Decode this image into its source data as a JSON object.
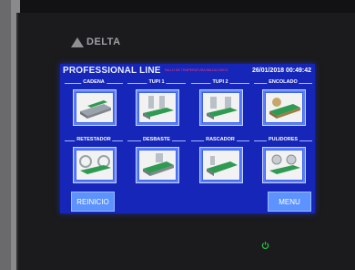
{
  "brand": {
    "logo_text": "DELTA"
  },
  "header": {
    "title": "PROFESSIONAL LINE",
    "warning": "FALLO DE TEMPERATURA BALDA   DISCO",
    "datetime": "26/01/2018 00:49:42"
  },
  "tiles": [
    {
      "label": "CADENA",
      "icon": "conveyor-chain-icon"
    },
    {
      "label": "TUPI 1",
      "icon": "spindle-1-icon"
    },
    {
      "label": "TUPI 2",
      "icon": "spindle-2-icon"
    },
    {
      "label": "ENCOLADO",
      "icon": "gluing-icon"
    },
    {
      "label": "RETESTADOR",
      "icon": "end-trimmer-icon"
    },
    {
      "label": "DESBASTE",
      "icon": "roughing-icon"
    },
    {
      "label": "RASCADOR",
      "icon": "scraper-icon"
    },
    {
      "label": "PULIDORES",
      "icon": "polisher-icon"
    }
  ],
  "buttons": {
    "reset_label": "REINICIO",
    "menu_label": "MENU"
  },
  "colors": {
    "screen_bg": "#1526b8",
    "button_bg": "#3a62e8",
    "accent_button": "#5c93ff",
    "warning": "#ff3b7a",
    "panel_green": "#2e9a52",
    "power_led": "#22cc44"
  }
}
